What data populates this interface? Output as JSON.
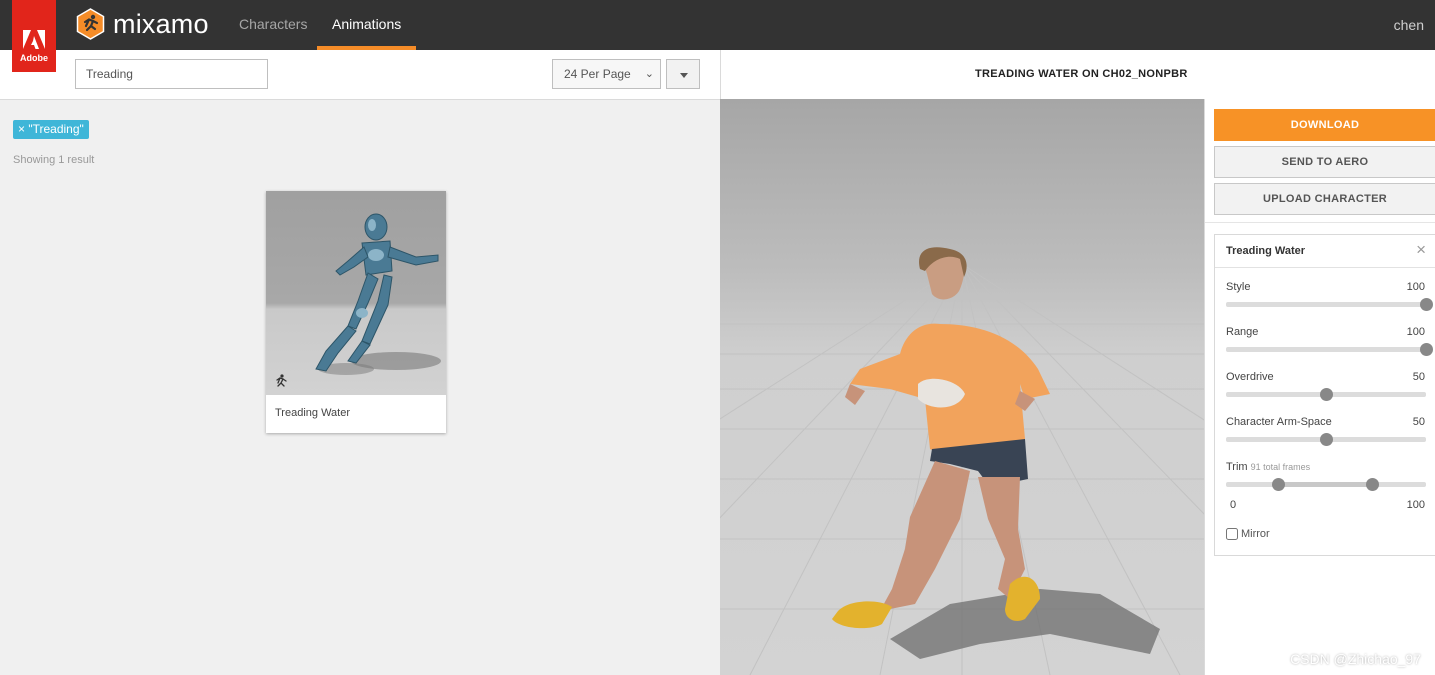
{
  "nav": {
    "adobe_label": "Adobe",
    "brand": "mixamo",
    "tabs": [
      {
        "label": "Characters",
        "active": false
      },
      {
        "label": "Animations",
        "active": true
      }
    ],
    "user": "chen",
    "accent_color": "#f58c28"
  },
  "search": {
    "value": "Treading",
    "per_page": "24 Per Page"
  },
  "results": {
    "filter_chip": "× \"Treading\"",
    "count_text": "Showing 1 result",
    "cards": [
      {
        "title": "Treading Water"
      }
    ]
  },
  "viewer": {
    "title": "TREADING WATER ON CH02_NONPBR"
  },
  "actions": {
    "download": "DOWNLOAD",
    "send_to_aero": "SEND TO AERO",
    "upload_character": "UPLOAD CHARACTER"
  },
  "settings": {
    "title": "Treading Water",
    "close": "×",
    "params": [
      {
        "label": "Style",
        "value": "100",
        "level": 1.0
      },
      {
        "label": "Range",
        "value": "100",
        "level": 1.0
      },
      {
        "label": "Overdrive",
        "value": "50",
        "level": 0.5
      },
      {
        "label": "Character Arm-Space",
        "value": "50",
        "level": 0.5
      }
    ],
    "trim": {
      "label": "Trim",
      "sub": "91 total frames",
      "min_label": "0",
      "max_label": "100",
      "start": 0.26,
      "end": 0.73
    },
    "mirror_label": "Mirror",
    "mirror_checked": false
  },
  "watermark": "CSDN @Zhichao_97"
}
